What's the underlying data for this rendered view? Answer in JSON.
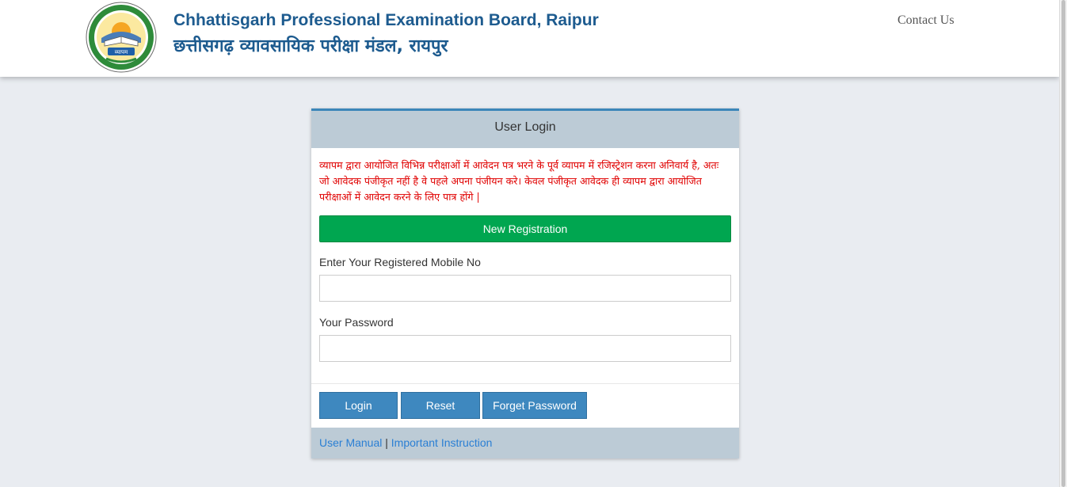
{
  "header": {
    "org_name_en": "Chhattisgarh Professional Examination Board, Raipur",
    "org_name_hi": "छत्तीसगढ़ व्यावसायिक परीक्षा मंडल, रायपुर",
    "contact_link": "Contact Us",
    "logo": {
      "icon": "vyapam-seal-logo",
      "text": "व्यापम",
      "colors": {
        "ring": "#2e8b3a",
        "inner": "#f7d44c",
        "sky": "#fbe9a0",
        "banner": "#1f5fa8"
      }
    }
  },
  "login_panel": {
    "title": "User Login",
    "notice": "व्यापम द्वारा आयोजित विभिन्न  परीक्षाओं में आवेदन पत्र भरने के पूर्व व्यापम में रजिस्ट्रेशन करना अनिवार्य है, अतः जो आवेदक पंजीकृत नहीं है वे पहले अपना  पंजीयन करे।  केवल पंजीकृत आवेदक ही व्यापम द्वारा आयोजित परीक्षाओं में आवेदन करने के लिए पात्र होंगे |",
    "new_registration_label": "New Registration",
    "mobile_label": "Enter Your Registered Mobile No",
    "mobile_value": "",
    "password_label": "Your Password",
    "password_value": "",
    "buttons": {
      "login": "Login",
      "reset": "Reset",
      "forget_password": "Forget Password"
    },
    "footer": {
      "user_manual": "User Manual",
      "separator": "|",
      "important_instruction": "Important Instruction"
    }
  },
  "colors": {
    "brand_blue": "#1d5b8f",
    "notice_red": "#e00000",
    "register_green": "#00a650",
    "button_blue": "#3e88bf",
    "panel_head": "#bccbd6",
    "link_blue": "#2a7fd4"
  }
}
